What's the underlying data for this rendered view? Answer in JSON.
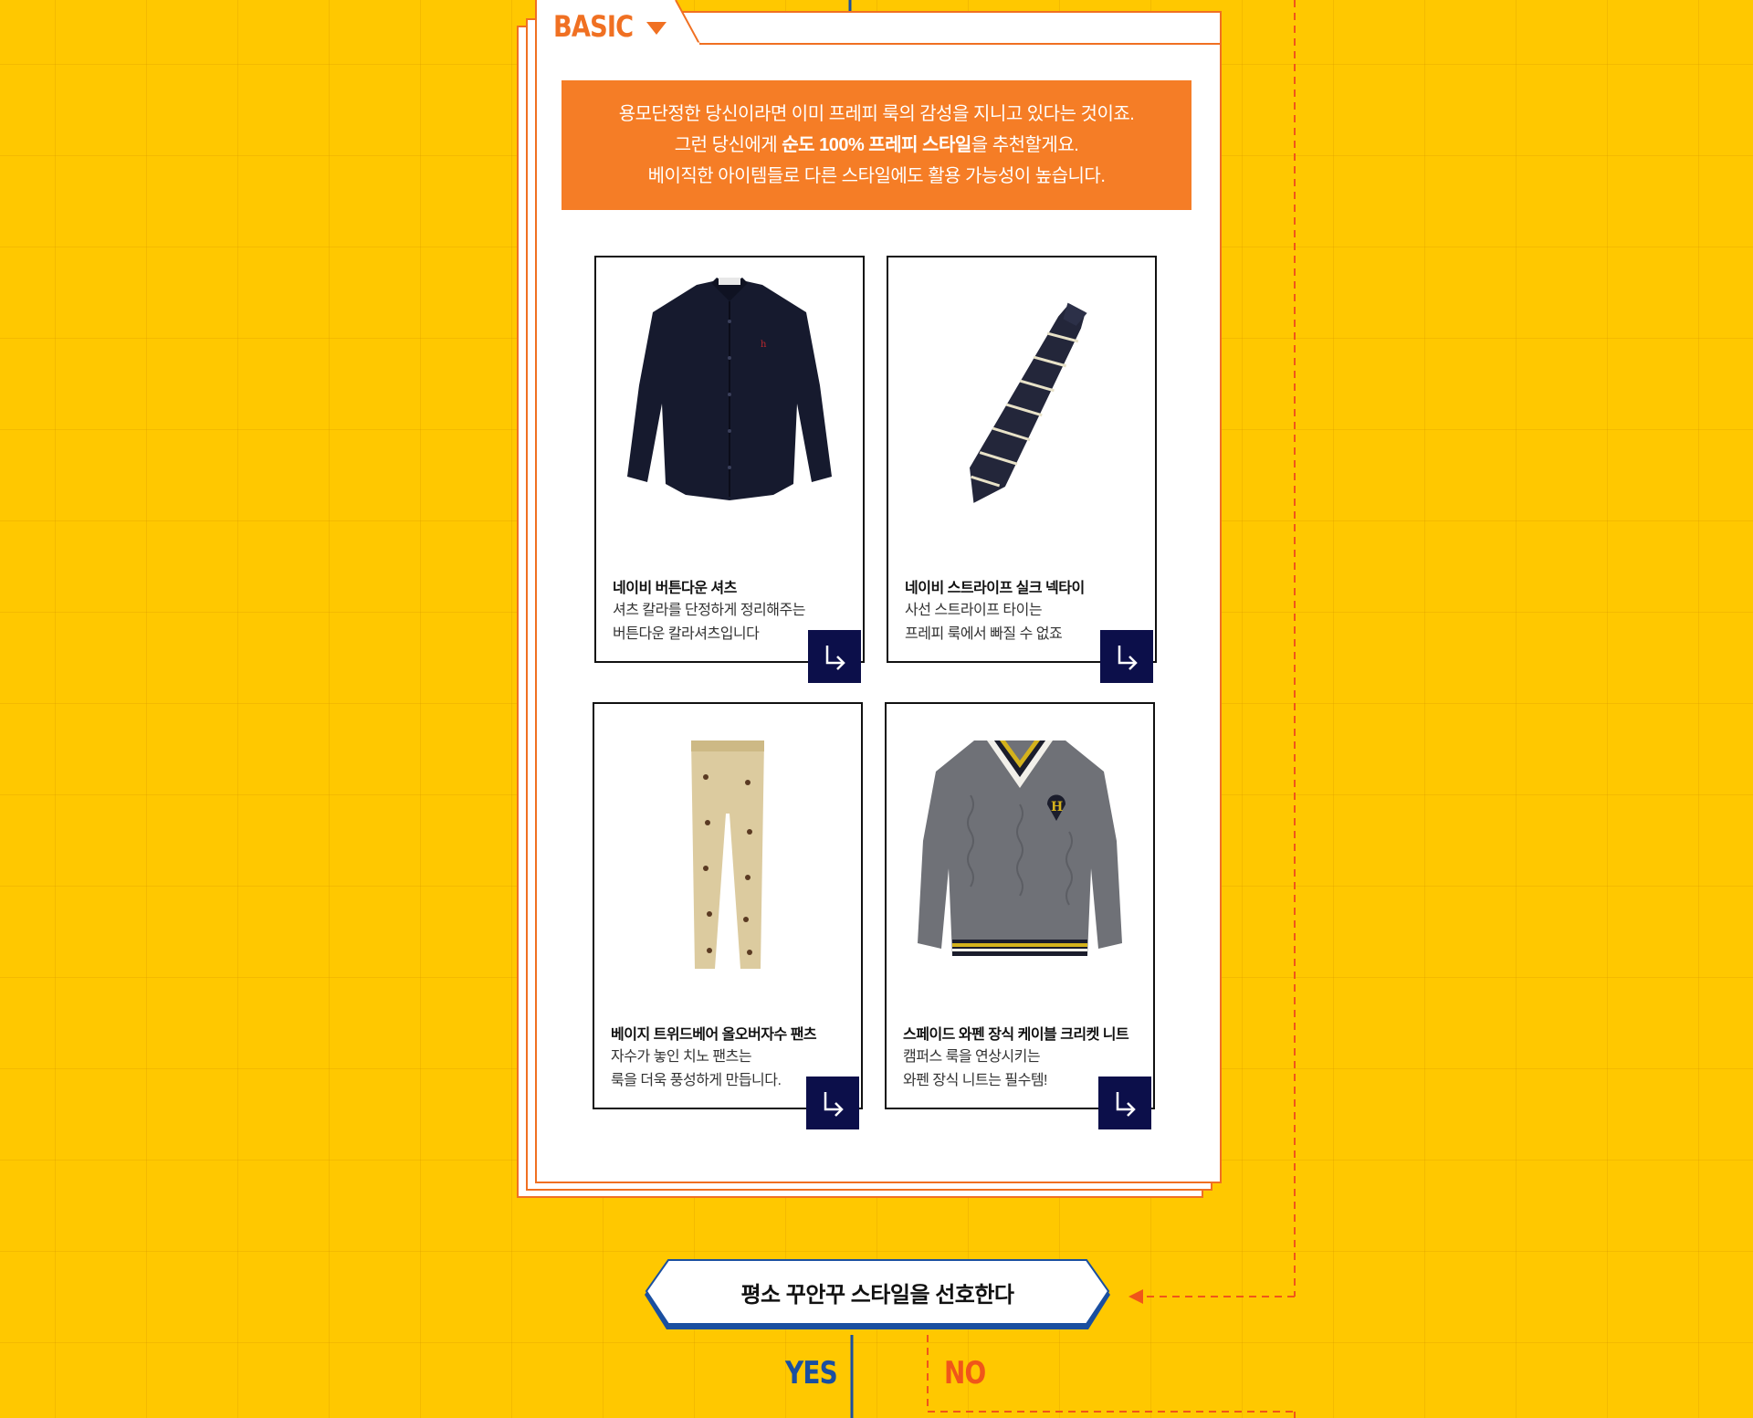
{
  "colors": {
    "background": "#ffc800",
    "accent_orange": "#f57d26",
    "navy": "#0c0f4a",
    "blue": "#1a4fa0",
    "red_dashed": "#f0561a"
  },
  "card": {
    "tab_label": "BASIC",
    "intro_line1": "용모단정한 당신이라면 이미 프레피 룩의 감성을 지니고 있다는 것이죠.",
    "intro_line2_pre": "그런 당신에게 ",
    "intro_line2_bold": "순도 100% 프레피 스타일",
    "intro_line2_post": "을 추천할게요.",
    "intro_line3": "베이직한 아이템들로 다른 스타일에도 활용 가능성이 높습니다."
  },
  "products": [
    {
      "name": "네이비 버튼다운 셔츠",
      "desc1": "셔츠 칼라를 단정하게 정리해주는",
      "desc2": "버튼다운 칼라셔츠입니다",
      "icon": "shirt-image"
    },
    {
      "name": "네이비 스트라이프 실크 넥타이",
      "desc1": "사선 스트라이프 타이는",
      "desc2": "프레피 룩에서 빠질 수 없죠",
      "icon": "necktie-image"
    },
    {
      "name": "베이지 트위드베어 올오버자수 팬츠",
      "desc1": "자수가 놓인 치노 팬츠는",
      "desc2": "룩을 더욱 풍성하게 만듭니다.",
      "icon": "pants-image"
    },
    {
      "name": "스페이드 와펜 장식 케이블 크리켓 니트",
      "desc1": "캠퍼스 룩을 연상시키는",
      "desc2": "와펜 장식 니트는 필수템!",
      "icon": "knit-image"
    }
  ],
  "flow": {
    "question": "평소 꾸안꾸 스타일을 선호한다",
    "yes": "YES",
    "no": "NO"
  }
}
